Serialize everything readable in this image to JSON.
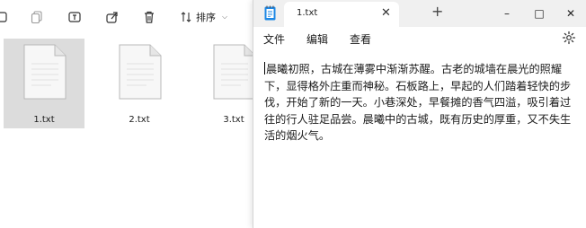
{
  "explorer": {
    "toolbar": {
      "icons": [
        "new-item-icon",
        "copy-icon",
        "rename-icon",
        "share-icon",
        "delete-icon"
      ],
      "sort_label": "排序"
    },
    "files": [
      {
        "name": "1.txt",
        "selected": true
      },
      {
        "name": "2.txt",
        "selected": false
      },
      {
        "name": "3.txt",
        "selected": false
      }
    ]
  },
  "notepad": {
    "tab_title": "1.txt",
    "new_tab": "+",
    "window_controls": {
      "minimize": "–",
      "maximize": "□",
      "close": "✕"
    },
    "menu": {
      "file": "文件",
      "edit": "编辑",
      "view": "查看"
    },
    "content": "晨曦初照，古城在薄雾中渐渐苏醒。古老的城墙在晨光的照耀下，显得格外庄重而神秘。石板路上，早起的人们踏着轻快的步伐，开始了新的一天。小巷深处，早餐摊的香气四溢，吸引着过往的行人驻足品尝。晨曦中的古城，既有历史的厚重，又不失生活的烟火气。"
  },
  "colors": {
    "titlebar_bg": "#f0f0f0",
    "selected_file_bg": "#dcdcdc",
    "app_icon_blue": "#1e88e5"
  }
}
